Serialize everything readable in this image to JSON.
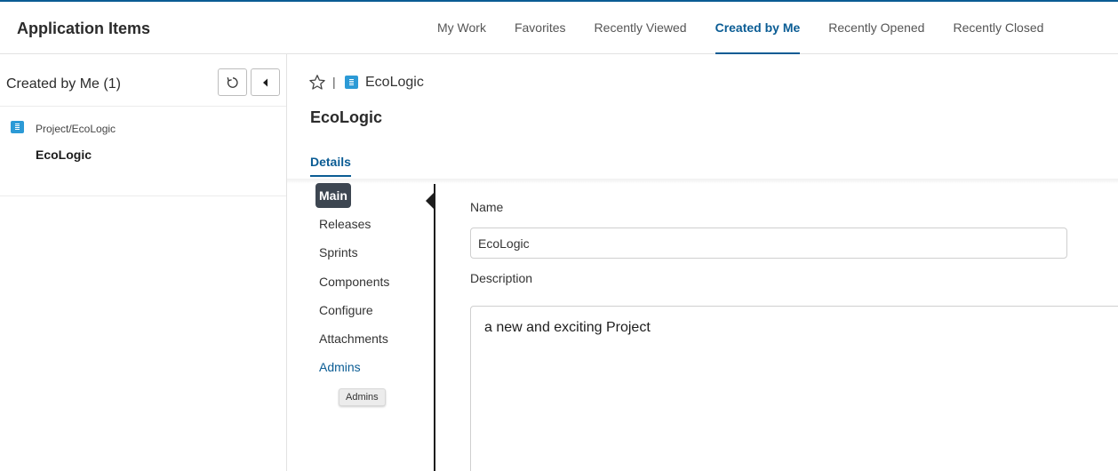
{
  "header": {
    "title": "Application Items",
    "tabs": [
      {
        "label": "My Work",
        "active": false
      },
      {
        "label": "Favorites",
        "active": false
      },
      {
        "label": "Recently Viewed",
        "active": false
      },
      {
        "label": "Created by Me",
        "active": true
      },
      {
        "label": "Recently Opened",
        "active": false
      },
      {
        "label": "Recently Closed",
        "active": false
      }
    ]
  },
  "left_panel": {
    "title": "Created by Me (1)",
    "buttons": {
      "refresh_icon": "refresh-icon",
      "collapse_icon": "caret-left-icon"
    },
    "items": [
      {
        "path": "Project/EcoLogic",
        "name": "EcoLogic",
        "icon": "project-icon"
      }
    ]
  },
  "main": {
    "breadcrumb": {
      "separator": "|",
      "name": "EcoLogic",
      "star_icon": "star-icon",
      "item_icon": "project-icon"
    },
    "title": "EcoLogic",
    "details_tab": "Details",
    "sub_nav": [
      {
        "label": "Main",
        "active": true
      },
      {
        "label": "Releases"
      },
      {
        "label": "Sprints"
      },
      {
        "label": "Components"
      },
      {
        "label": "Configure"
      },
      {
        "label": "Attachments"
      },
      {
        "label": "Admins",
        "hovered": true
      }
    ],
    "tooltip": "Admins",
    "form": {
      "name_label": "Name",
      "name_value": "EcoLogic",
      "description_label": "Description",
      "description_value": "a new and exciting Project"
    }
  },
  "colors": {
    "accent": "#0a5c94",
    "project_icon": "#2c9ad6",
    "active_subnav_bg": "#3d4651"
  }
}
